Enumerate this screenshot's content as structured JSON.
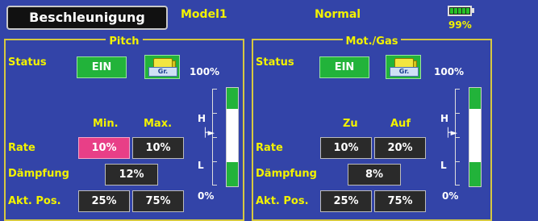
{
  "header": {
    "title": "Beschleunigung",
    "model": "Model1",
    "mode": "Normal",
    "battery": "99%"
  },
  "pitch": {
    "title": "Pitch",
    "status_label": "Status",
    "status_value": "EIN",
    "group_label": "Gr.",
    "top_pct": "100%",
    "bottom_pct": "0%",
    "h_label": "H",
    "l_label": "L",
    "col1": "Min.",
    "col2": "Max.",
    "rate_label": "Rate",
    "rate1": "10%",
    "rate2": "10%",
    "damp_label": "Dämpfung",
    "damp": "12%",
    "pos_label": "Akt. Pos.",
    "pos1": "25%",
    "pos2": "75%"
  },
  "gas": {
    "title": "Mot./Gas",
    "status_label": "Status",
    "status_value": "EIN",
    "group_label": "Gr.",
    "top_pct": "100%",
    "bottom_pct": "0%",
    "h_label": "H",
    "l_label": "L",
    "col1": "Zu",
    "col2": "Auf",
    "rate_label": "Rate",
    "rate1": "10%",
    "rate2": "20%",
    "damp_label": "Dämpfung",
    "damp": "8%",
    "pos_label": "Akt. Pos.",
    "pos1": "25%",
    "pos2": "75%"
  },
  "colors": {
    "bg": "#3344a8",
    "accent": "#f2f200",
    "active": "#22b33a",
    "selected": "#e83f87"
  }
}
